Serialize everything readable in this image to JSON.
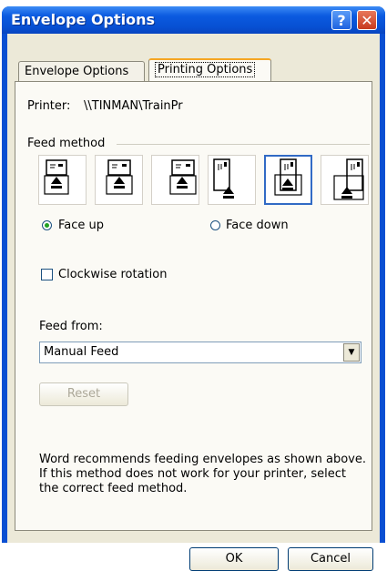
{
  "window": {
    "title": "Envelope Options",
    "help_glyph": "?",
    "close_glyph": "✕"
  },
  "tabs": [
    {
      "label": "Envelope Options",
      "active": false
    },
    {
      "label": "Printing Options",
      "active": true
    }
  ],
  "printer": {
    "label": "Printer:",
    "value": "\\\\TINMAN\\TrainPr"
  },
  "feed_method": {
    "heading": "Feed method",
    "selected_index": 4,
    "options": [
      {
        "icon": "landscape-left-feed-icon"
      },
      {
        "icon": "landscape-center-feed-icon"
      },
      {
        "icon": "landscape-right-feed-icon"
      },
      {
        "icon": "portrait-left-feed-icon"
      },
      {
        "icon": "portrait-center-feed-icon"
      },
      {
        "icon": "portrait-right-feed-icon"
      }
    ]
  },
  "face": {
    "up_label": "Face up",
    "down_label": "Face down",
    "selected": "up"
  },
  "clockwise": {
    "label": "Clockwise rotation",
    "checked": false
  },
  "feed_from": {
    "label": "Feed from:",
    "value": "Manual Feed"
  },
  "reset_label": "Reset",
  "info_text": "Word recommends feeding envelopes as shown above. If this method does not work for your printer, select the correct feed method.",
  "buttons": {
    "ok": "OK",
    "cancel": "Cancel"
  },
  "colors": {
    "title_bar": "#0a4fd2",
    "selection_border": "#316ac5",
    "radio_dot": "#21a121"
  }
}
